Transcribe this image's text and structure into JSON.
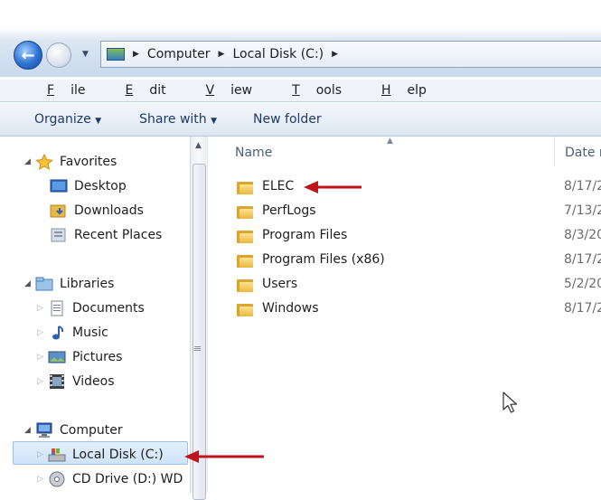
{
  "breadcrumb": [
    "Computer",
    "Local Disk (C:)"
  ],
  "menu": [
    "File",
    "Edit",
    "View",
    "Tools",
    "Help"
  ],
  "menu_accel": [
    "F",
    "E",
    "V",
    "T",
    "H"
  ],
  "commands": {
    "organize": "Organize",
    "share_with": "Share with",
    "new_folder": "New folder"
  },
  "nav": {
    "favorites": {
      "label": "Favorites",
      "items": [
        "Desktop",
        "Downloads",
        "Recent Places"
      ]
    },
    "libraries": {
      "label": "Libraries",
      "items": [
        "Documents",
        "Music",
        "Pictures",
        "Videos"
      ]
    },
    "computer": {
      "label": "Computer",
      "items": [
        "Local Disk (C:)",
        "CD Drive (D:) WD"
      ]
    }
  },
  "columns": {
    "name": "Name",
    "date": "Date m"
  },
  "files": [
    {
      "name": "ELEC",
      "date": "8/17/2"
    },
    {
      "name": "PerfLogs",
      "date": "7/13/2"
    },
    {
      "name": "Program Files",
      "date": "8/3/20"
    },
    {
      "name": "Program Files (x86)",
      "date": "8/17/2"
    },
    {
      "name": "Users",
      "date": "5/2/20"
    },
    {
      "name": "Windows",
      "date": "8/17/2"
    }
  ],
  "colors": {
    "annotation_arrow": "#c0161b",
    "selection": "#cfe3f8",
    "command_text": "#1f3a66"
  },
  "icons": {
    "back": "back-arrow-icon",
    "forward": "forward-arrow-icon",
    "folder": "folder-icon",
    "star": "star-icon",
    "drive": "drive-icon"
  }
}
